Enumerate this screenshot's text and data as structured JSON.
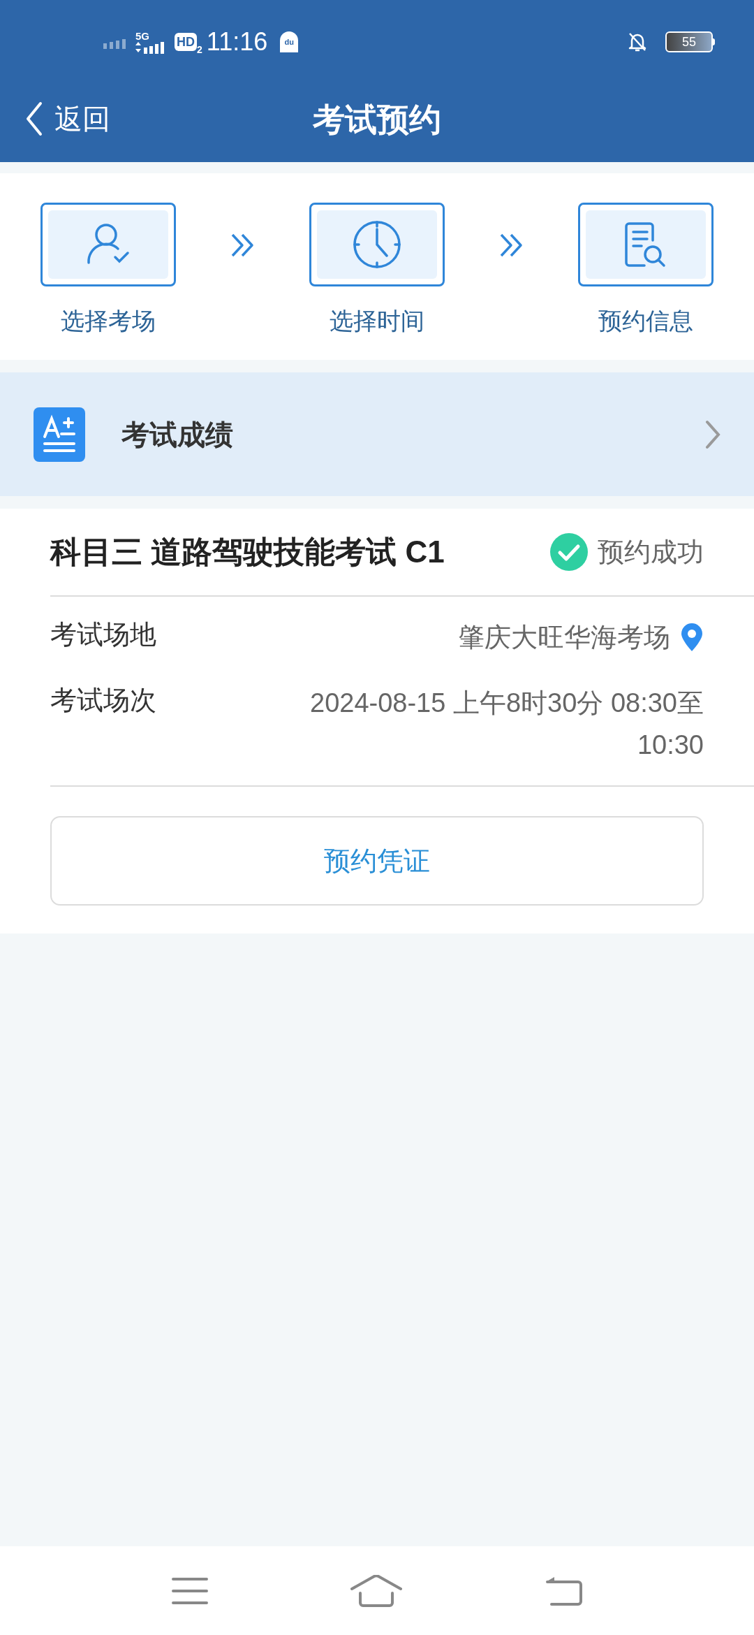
{
  "status_bar": {
    "network": "5G",
    "hd": "HD",
    "hd_sub": "2",
    "time": "11:16",
    "map_badge": "du",
    "battery": "55"
  },
  "header": {
    "back_label": "返回",
    "title": "考试预约"
  },
  "steps": [
    {
      "label": "选择考场",
      "kind": "person"
    },
    {
      "label": "选择时间",
      "kind": "clock"
    },
    {
      "label": "预约信息",
      "kind": "document"
    }
  ],
  "score_entry": {
    "label": "考试成绩"
  },
  "exam": {
    "subject": "科目三 道路驾驶技能考试 C1",
    "status": {
      "text": "预约成功",
      "kind": "success"
    },
    "rows": [
      {
        "label": "考试场地",
        "value": "肇庆大旺华海考场",
        "kind": "location"
      },
      {
        "label": "考试场次",
        "value": "2024-08-15 上午8时30分 08:30至 10:30",
        "kind": "plain"
      }
    ],
    "button": "预约凭证"
  }
}
